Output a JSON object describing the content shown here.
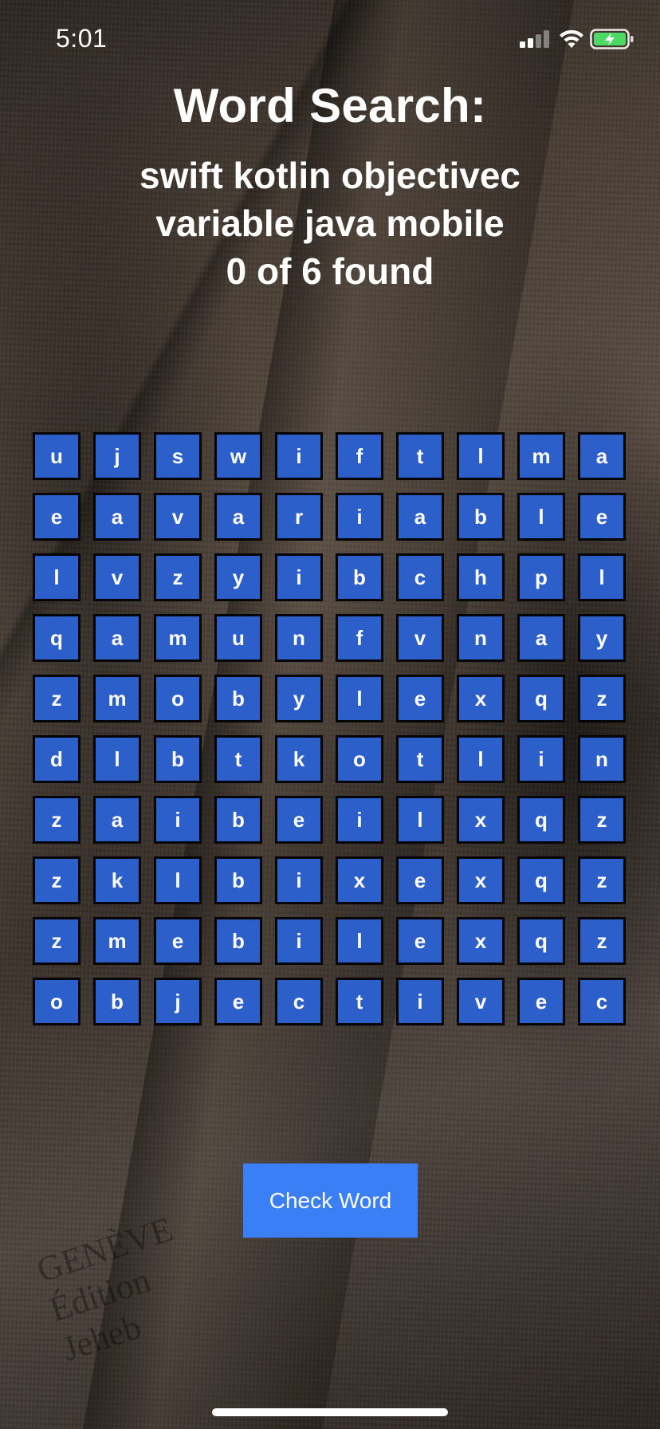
{
  "status_bar": {
    "time": "5:01",
    "icons": [
      "signal-icon",
      "wifi-icon",
      "battery-charging-icon"
    ],
    "battery_color": "#4cd964"
  },
  "header": {
    "title": "Word Search:",
    "word_lines": [
      "swift kotlin objectivec",
      "variable java mobile"
    ],
    "progress": "0 of 6 found"
  },
  "grid": {
    "cell_color": "#2c5fc9",
    "rows": [
      [
        "u",
        "j",
        "s",
        "w",
        "i",
        "f",
        "t",
        "l",
        "m",
        "a"
      ],
      [
        "e",
        "a",
        "v",
        "a",
        "r",
        "i",
        "a",
        "b",
        "l",
        "e"
      ],
      [
        "l",
        "v",
        "z",
        "y",
        "i",
        "b",
        "c",
        "h",
        "p",
        "l"
      ],
      [
        "q",
        "a",
        "m",
        "u",
        "n",
        "f",
        "v",
        "n",
        "a",
        "y"
      ],
      [
        "z",
        "m",
        "o",
        "b",
        "y",
        "l",
        "e",
        "x",
        "q",
        "z"
      ],
      [
        "d",
        "l",
        "b",
        "t",
        "k",
        "o",
        "t",
        "l",
        "i",
        "n"
      ],
      [
        "z",
        "a",
        "i",
        "b",
        "e",
        "i",
        "l",
        "x",
        "q",
        "z"
      ],
      [
        "z",
        "k",
        "l",
        "b",
        "i",
        "x",
        "e",
        "x",
        "q",
        "z"
      ],
      [
        "z",
        "m",
        "e",
        "b",
        "i",
        "l",
        "e",
        "x",
        "q",
        "z"
      ],
      [
        "o",
        "b",
        "j",
        "e",
        "c",
        "t",
        "i",
        "v",
        "e",
        "c"
      ]
    ]
  },
  "actions": {
    "check_word_label": "Check Word",
    "button_color": "#3a7ff6"
  },
  "background": {
    "spine_print": [
      "GENÈVE",
      "Édition",
      "Jeheb"
    ]
  }
}
